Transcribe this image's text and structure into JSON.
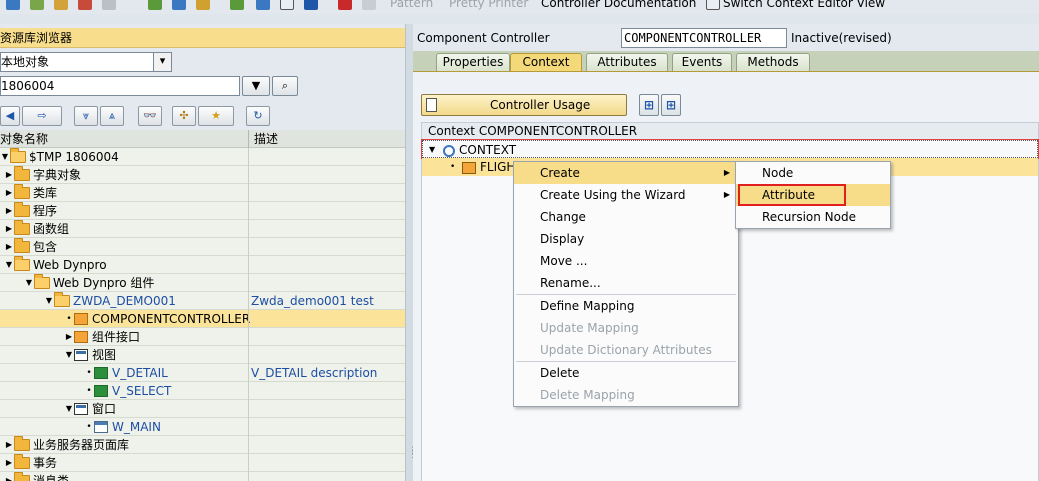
{
  "toolbar": {
    "pattern_label": "Pattern",
    "pretty_printer_label": "Pretty Printer",
    "controller_doc_label": "Controller Documentation",
    "switch_editor_label": "Switch Context Editor View"
  },
  "left": {
    "title": "资源库浏览器",
    "object_type": "本地对象",
    "object_value": "1806004",
    "columns": {
      "name": "对象名称",
      "desc": "描述"
    },
    "tree": {
      "root": "$TMP 1806004",
      "dict": "字典对象",
      "classlib": "类库",
      "programs": "程序",
      "funcgroups": "函数组",
      "packages": "包含",
      "webdynpro": "Web Dynpro",
      "wd_components": "Web Dynpro 组件",
      "zwda": "ZWDA_DEMO001",
      "zwda_desc": "Zwda_demo001 test",
      "compctrl": "COMPONENTCONTROLLER",
      "comp_iface": "组件接口",
      "views": "视图",
      "v_detail": "V_DETAIL",
      "v_detail_desc": "V_DETAIL description",
      "v_select": "V_SELECT",
      "windows": "窗口",
      "w_main": "W_MAIN",
      "bsp": "业务服务器页面库",
      "transactions": "事务",
      "messages": "消息类"
    }
  },
  "right": {
    "cc_label": "Component Controller",
    "cc_value": "COMPONENTCONTROLLER",
    "cc_status": "Inactive(revised)",
    "tabs": [
      "Properties",
      "Context",
      "Attributes",
      "Events",
      "Methods"
    ],
    "active_tab": "Context",
    "usage_button": "Controller Usage",
    "ctx_header": "Context COMPONENTCONTROLLER",
    "ctx_root": "CONTEXT",
    "ctx_child": "FLIGH"
  },
  "menu": {
    "create": "Create",
    "create_wizard": "Create Using the Wizard",
    "change": "Change",
    "display": "Display",
    "move": "Move ...",
    "rename": "Rename...",
    "define_mapping": "Define Mapping",
    "update_mapping": "Update Mapping",
    "update_dict": "Update Dictionary Attributes",
    "delete": "Delete",
    "delete_mapping": "Delete Mapping"
  },
  "submenu": {
    "node": "Node",
    "attribute": "Attribute",
    "recursion": "Recursion Node"
  }
}
